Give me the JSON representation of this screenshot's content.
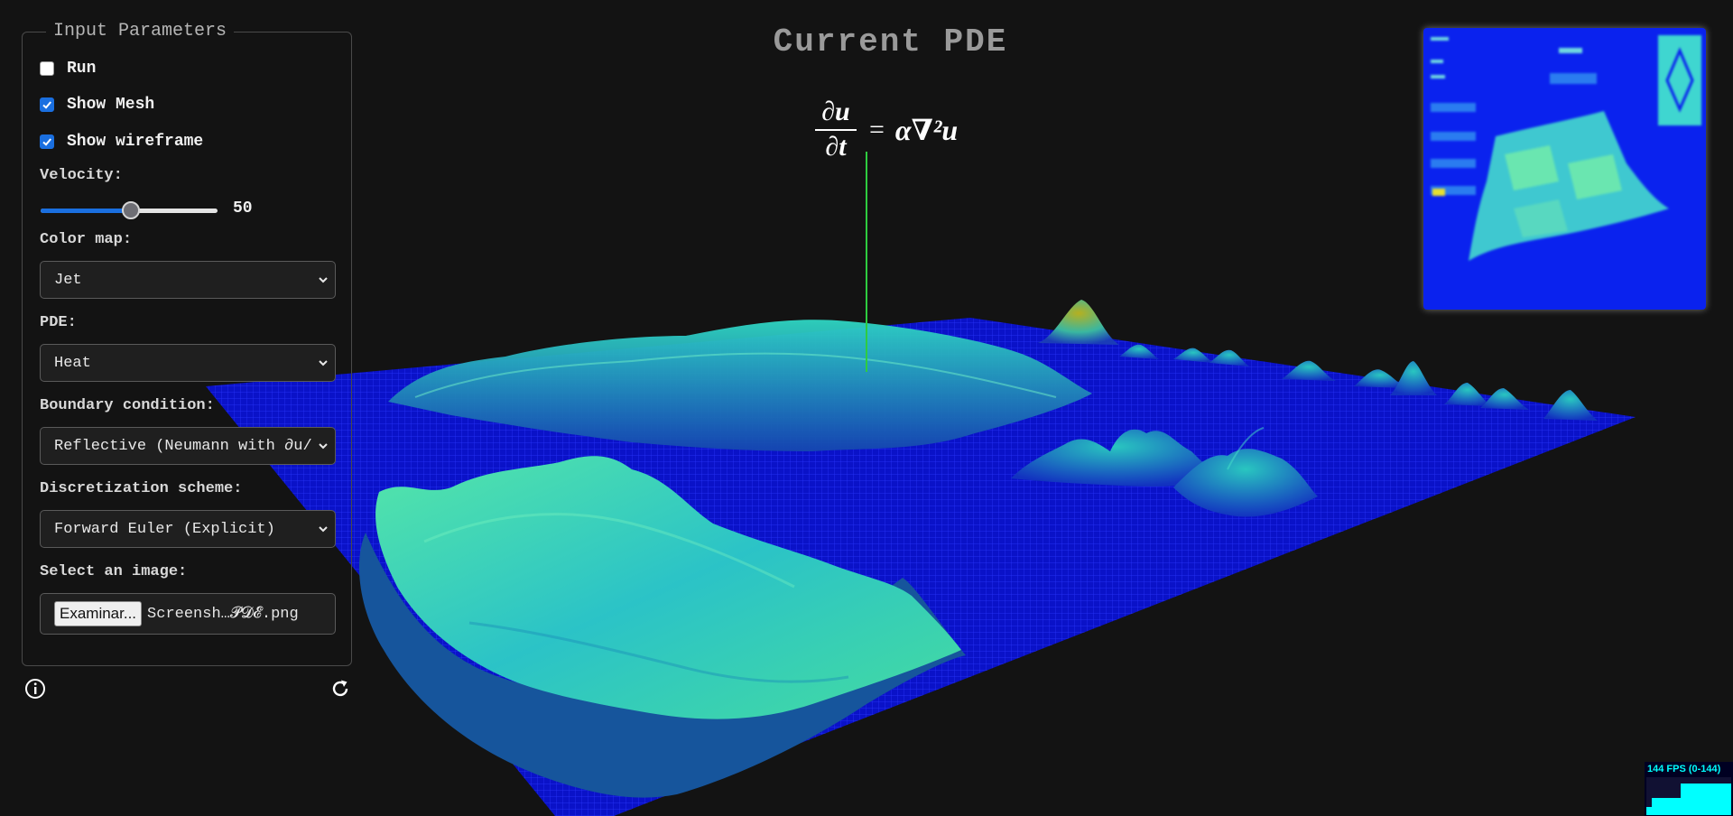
{
  "panel": {
    "legend": "Input Parameters",
    "run_label": "Run",
    "run_checked": false,
    "mesh_label": "Show Mesh",
    "mesh_checked": true,
    "wireframe_label": "Show wireframe",
    "wireframe_checked": true,
    "velocity_label": "Velocity:",
    "velocity_value": "50",
    "velocity_fraction": 0.5,
    "colormap_label": "Color map:",
    "colormap_value": "Jet",
    "pde_label": "PDE:",
    "pde_value": "Heat",
    "boundary_label": "Boundary condition:",
    "boundary_value": "Reflective (Neumann with ∂u/",
    "scheme_label": "Discretization scheme:",
    "scheme_value": "Forward Euler (Explicit)",
    "image_label": "Select an image:",
    "file_button": "Examinar...",
    "file_name": "Screensh…𝓟𝓓𝓔.png",
    "info_icon": "info-icon",
    "reset_icon": "refresh-icon"
  },
  "main": {
    "title": "Current PDE",
    "equation": {
      "numerator": "∂u",
      "denominator": "∂t",
      "equals": "=",
      "rhs": "α∇²u"
    }
  },
  "fps": {
    "label": "144 FPS (0-144)"
  },
  "colors": {
    "background": "#131313",
    "accent": "#1a6fe0",
    "surface_low": "#0a14d8",
    "surface_mid": "#1fb9b0",
    "surface_high": "#6fe08f",
    "fps_text": "#00ffff"
  }
}
